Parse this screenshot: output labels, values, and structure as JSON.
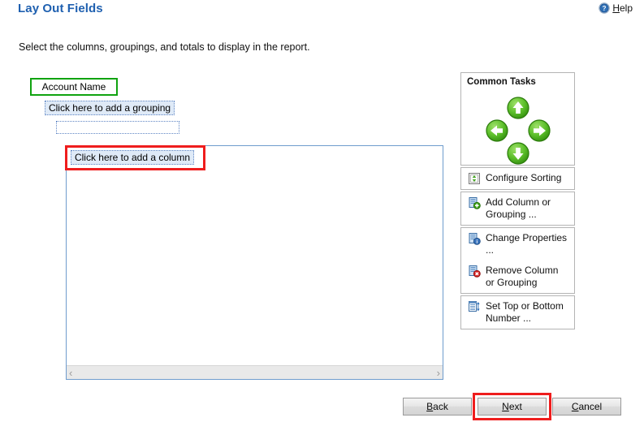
{
  "header": {
    "title": "Lay Out Fields",
    "help": {
      "label_accel": "H",
      "label_rest": "elp",
      "icon": "help-circle-icon"
    }
  },
  "subtitle": "Select the columns, groupings, and totals to display in the report.",
  "design_area": {
    "account_field": "Account Name",
    "grouping_placeholder": "Click here to add a grouping",
    "empty_grouping_placeholder": "",
    "column_placeholder": "Click here to add a column",
    "scrollbar": {
      "left_arrow": "‹",
      "right_arrow": "›"
    }
  },
  "tasks_panel": {
    "header": "Common Tasks",
    "nav": [
      {
        "name": "move-up-button",
        "icon": "arrow-up-icon",
        "direction": "up"
      },
      {
        "name": "move-left-button",
        "icon": "arrow-left-icon",
        "direction": "left"
      },
      {
        "name": "move-right-button",
        "icon": "arrow-right-icon",
        "direction": "right"
      },
      {
        "name": "move-down-button",
        "icon": "arrow-down-icon",
        "direction": "down"
      }
    ],
    "groups": [
      {
        "items": [
          {
            "label": "Configure Sorting",
            "icon": "sort-icon"
          }
        ]
      },
      {
        "items": [
          {
            "label": "Add Column or Grouping ...",
            "icon": "add-column-icon"
          }
        ]
      },
      {
        "items": [
          {
            "label": "Change Properties ...",
            "icon": "properties-icon"
          },
          {
            "label": "Remove Column or Grouping",
            "icon": "remove-column-icon"
          }
        ]
      },
      {
        "items": [
          {
            "label": "Set Top or Bottom Number ...",
            "icon": "top-bottom-icon"
          }
        ]
      }
    ]
  },
  "footer": {
    "back": {
      "accel": "B",
      "rest": "ack"
    },
    "next": {
      "accel": "N",
      "rest": "ext"
    },
    "cancel": {
      "accel": "C",
      "rest": "ancel"
    }
  },
  "highlights": {
    "account_field_color": "#10a310",
    "column_placeholder_color": "#ef1d1d",
    "next_button_color": "#ef1d1d"
  },
  "colors": {
    "title": "#1f60b0",
    "panel_border": "#6f9ccd",
    "placeholder_fill": "#dfeaf7",
    "placeholder_border": "#5f86c4"
  }
}
